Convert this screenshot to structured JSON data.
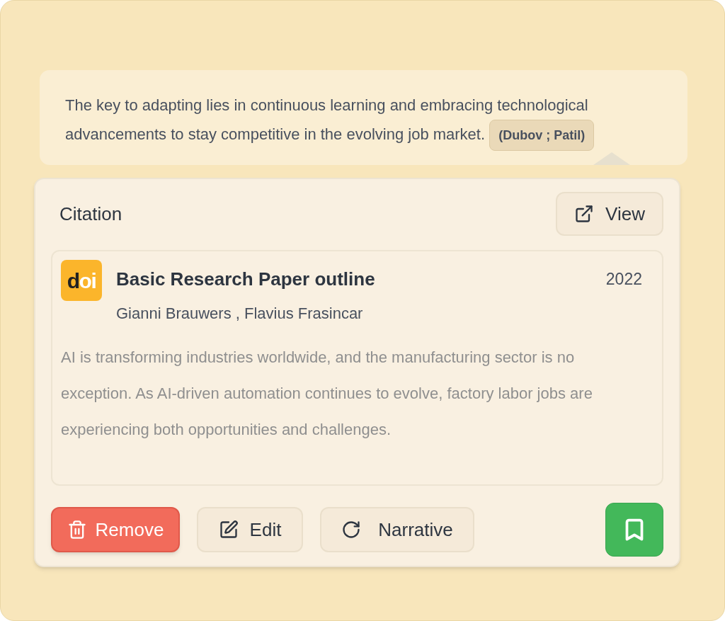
{
  "quote": {
    "text": "The key to adapting lies in continuous learning and embracing technological advancements to stay competitive in the evolving job market.",
    "citation": "(Dubov ; Patil)"
  },
  "card": {
    "title": "Citation",
    "view_button": "View",
    "source": {
      "logo": {
        "dark": "d",
        "light": "oi"
      },
      "title": "Basic Research Paper outline",
      "year": "2022",
      "authors": "Gianni Brauwers , Flavius Frasincar",
      "abstract": "AI is transforming industries worldwide, and the manufacturing sector is no exception. As AI-driven automation continues to evolve, factory labor jobs are experiencing both opportunities and challenges."
    },
    "actions": [
      {
        "kind": "remove",
        "label": "Remove"
      },
      {
        "kind": "edit",
        "label": "Edit"
      },
      {
        "kind": "narrative",
        "label": "Narrative"
      }
    ]
  }
}
